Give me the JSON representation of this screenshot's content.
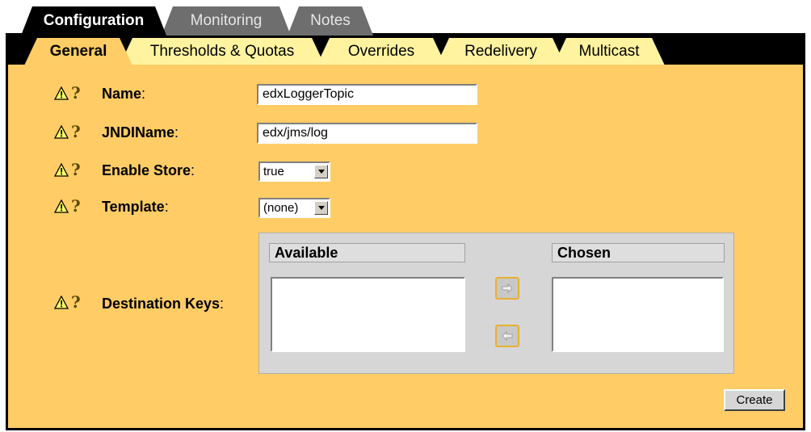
{
  "top_tabs": [
    {
      "label": "Configuration"
    },
    {
      "label": "Monitoring"
    },
    {
      "label": "Notes"
    }
  ],
  "sub_tabs": [
    {
      "label": "General"
    },
    {
      "label": "Thresholds & Quotas"
    },
    {
      "label": "Overrides"
    },
    {
      "label": "Redelivery"
    },
    {
      "label": "Multicast"
    }
  ],
  "fields": {
    "name": {
      "label": "Name",
      "value": "edxLoggerTopic"
    },
    "jndi": {
      "label": "JNDIName",
      "value": "edx/jms/log"
    },
    "store": {
      "label": "Enable Store",
      "value": "true"
    },
    "template": {
      "label": "Template",
      "value": "(none)"
    },
    "dest_keys": {
      "label": "Destination Keys",
      "available": "Available",
      "chosen": "Chosen"
    }
  },
  "colon": ":",
  "buttons": {
    "create": "Create"
  },
  "icons": {
    "warning": "warning-icon",
    "help": "help-icon",
    "move_right": "arrow-right-icon",
    "move_left": "arrow-left-icon"
  },
  "colors": {
    "panel_bg": "#ffcc66",
    "active_tab": "#000000",
    "inactive_tab": "#6e6e6e",
    "subtab_inactive": "#fff3a0"
  }
}
